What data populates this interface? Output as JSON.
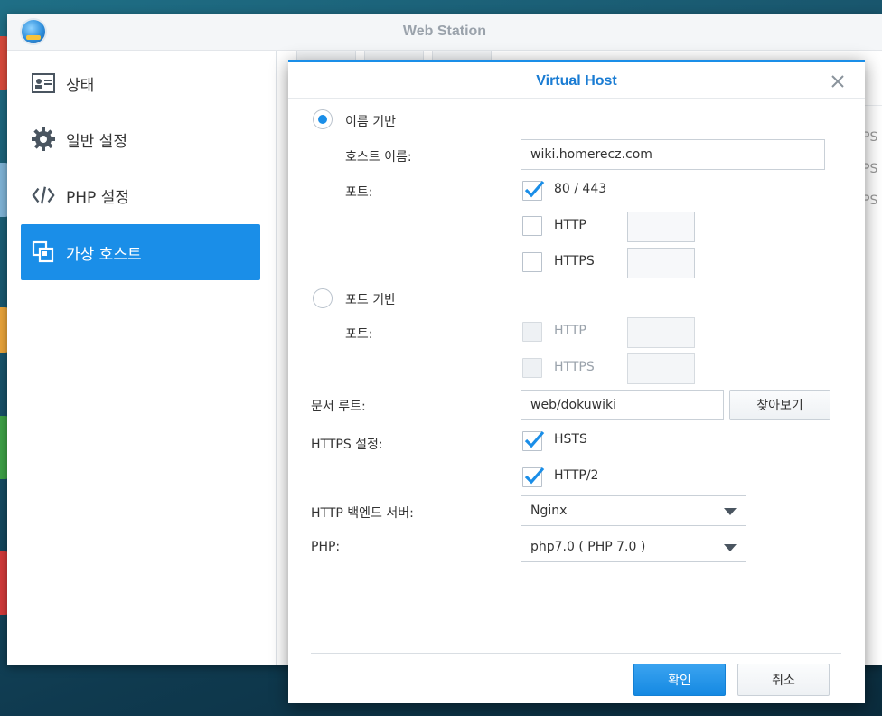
{
  "window": {
    "title": "Web Station"
  },
  "sidebar": {
    "items": [
      {
        "label": "상태",
        "icon": "status-card-icon",
        "active": false
      },
      {
        "label": "일반 설정",
        "icon": "gear-icon",
        "active": false
      },
      {
        "label": "PHP 설정",
        "icon": "code-icon",
        "active": false
      },
      {
        "label": "가상 호스트",
        "icon": "virtual-host-icon",
        "active": true
      }
    ]
  },
  "background": {
    "right_fragments": [
      "PS",
      "PS",
      "PS"
    ]
  },
  "dialog": {
    "title": "Virtual Host",
    "name_based": {
      "radio_label": "이름 기반",
      "selected": true,
      "hostname_label": "호스트 이름:",
      "hostname_value": "wiki.homerecz.com",
      "port_label": "포트:",
      "port_default": {
        "label": "80 / 443",
        "checked": true
      },
      "http": {
        "label": "HTTP",
        "checked": false,
        "value": ""
      },
      "https": {
        "label": "HTTPS",
        "checked": false,
        "value": ""
      }
    },
    "port_based": {
      "radio_label": "포트 기반",
      "selected": false,
      "port_label": "포트:",
      "http": {
        "label": "HTTP",
        "checked": false,
        "value": ""
      },
      "https": {
        "label": "HTTPS",
        "checked": false,
        "value": ""
      }
    },
    "document_root": {
      "label": "문서 루트:",
      "value": "web/dokuwiki",
      "browse_label": "찾아보기"
    },
    "https_settings": {
      "label": "HTTPS 설정:",
      "hsts": {
        "label": "HSTS",
        "checked": true
      },
      "http2": {
        "label": "HTTP/2",
        "checked": true
      }
    },
    "backend": {
      "label": "HTTP 백엔드 서버:",
      "value": "Nginx"
    },
    "php": {
      "label": "PHP:",
      "value": "php7.0 ( PHP 7.0 )"
    },
    "buttons": {
      "ok": "확인",
      "cancel": "취소"
    }
  },
  "colors": {
    "accent": "#1a8ee8",
    "title_blue": "#1a7cd3"
  }
}
